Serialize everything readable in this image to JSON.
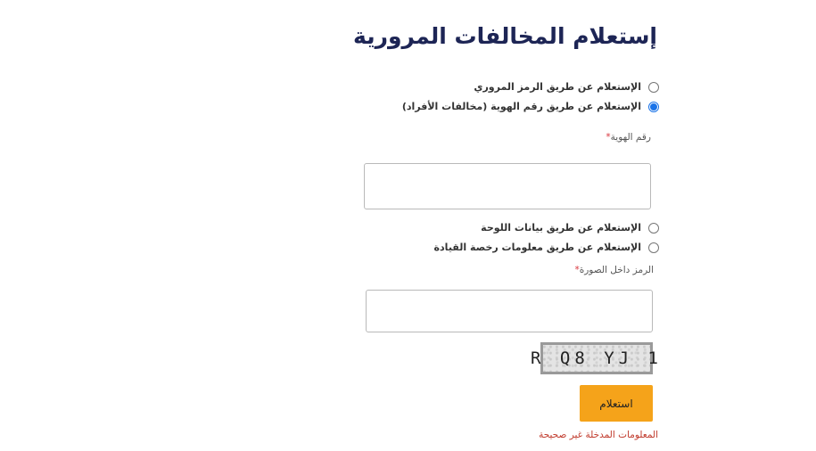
{
  "page": {
    "title": "إستعلام المخالفات المرورية"
  },
  "options": [
    {
      "label": "الإستعلام عن طريق الرمز المروري",
      "checked": false
    },
    {
      "label": "الإستعلام عن طريق رقم الهوية (مخالفات الأفراد)",
      "checked": true
    },
    {
      "label": "الإستعلام عن طريق بيانات اللوحة",
      "checked": false
    },
    {
      "label": "الإستعلام عن طريق معلومات رخصة القيادة",
      "checked": false
    }
  ],
  "id_field": {
    "label": "رقم الهوية",
    "required_mark": "*",
    "value": ""
  },
  "captcha_field": {
    "label": "الرمز داخل الصورة",
    "required_mark": "*",
    "value": "",
    "image_text": "R Q8 YJ 1"
  },
  "submit": {
    "label": "استعلام",
    "color": "#f5a31a"
  },
  "error": {
    "message": "المعلومات المدخلة غير صحيحة",
    "color": "#c0392b"
  },
  "colors": {
    "title": "#1d2555",
    "radio_checked": "#1a73e8",
    "required": "#d9363e"
  }
}
